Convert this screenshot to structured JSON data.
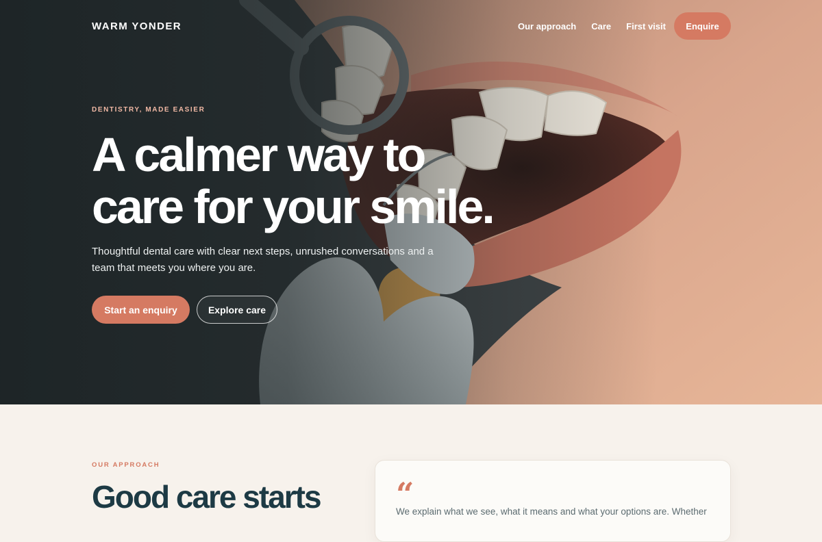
{
  "brand": "WARM YONDER",
  "nav": {
    "links": [
      "Our approach",
      "Care",
      "First visit"
    ],
    "cta": "Enquire"
  },
  "hero": {
    "eyebrow": "DENTISTRY, MADE EASIER",
    "title_line1": "A calmer way to",
    "title_line2": "care for your smile.",
    "subtitle": "Thoughtful dental care with clear next steps, unrushed conversations and a team that meets you where you are.",
    "primary_button": "Start an enquiry",
    "secondary_button": "Explore care"
  },
  "approach": {
    "eyebrow": "OUR APPROACH",
    "title": "Good care starts",
    "quote_mark": "“",
    "quote_text": "We explain what we see, what it means and what your options are. Whether"
  },
  "colors": {
    "accent": "#d57a62",
    "ink": "#1d3a44",
    "cream": "#f7f2ec"
  }
}
